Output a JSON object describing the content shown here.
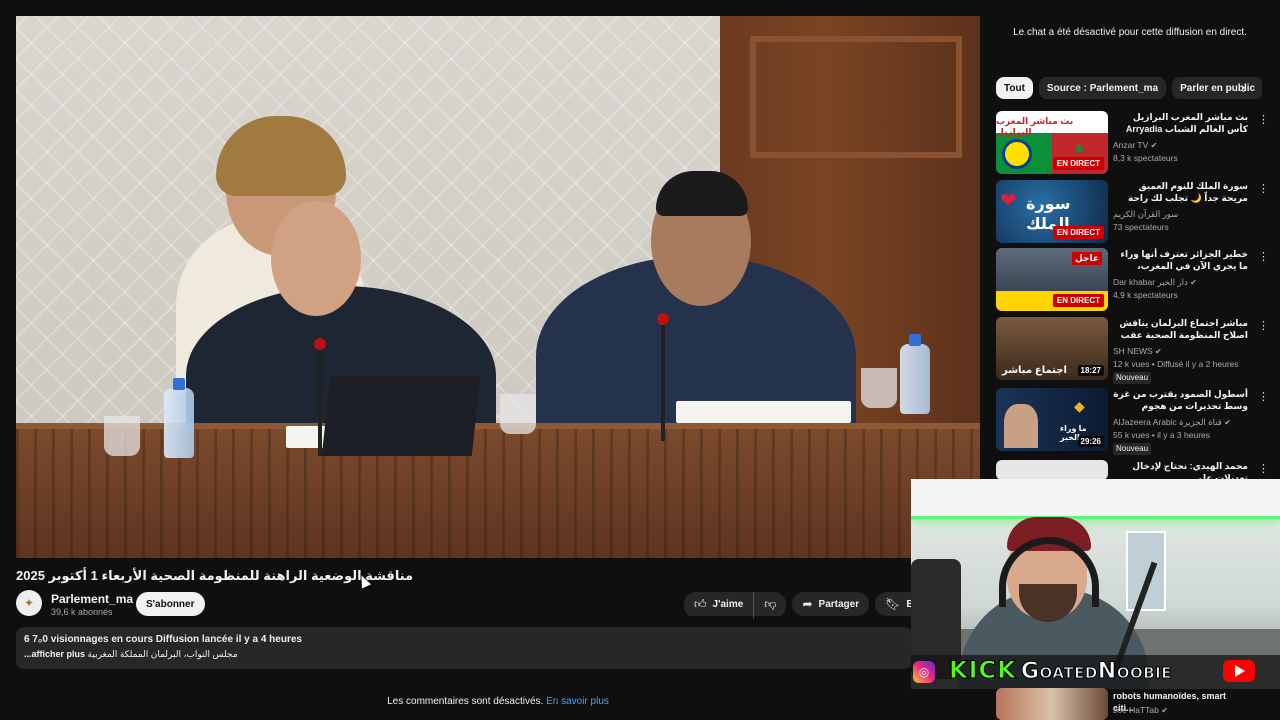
{
  "video": {
    "title": "مناقشة الوضعية الراهنة للمنظومة الصحية الأربعاء 1 أكتوبر 2025",
    "channel_name": "Parlement_ma",
    "channel_subs": "39,6 k abonnés",
    "subscribe_label": "S'abonner",
    "like_label": "J'aime",
    "share_label": "Partager",
    "save_label": "Enre",
    "description": {
      "line1_count": "6 7₀0",
      "line1_text": " visionnages en cours  Diffusion lancée il y a 4 heures",
      "line2_tags": "مجلس النواب، البرلمان المملكة المغربية",
      "line2_more": "...afficher plus"
    },
    "comments_disabled": "Les commentaires sont désactivés.",
    "comments_learn_more": "En savoir plus"
  },
  "sidebar": {
    "chat_disabled": "Le chat a été désactivé pour cette diffusion en direct.",
    "chips": [
      "Tout",
      "Source : Parlement_ma",
      "Parler en public"
    ],
    "recommendations": [
      {
        "title": "بث مباشر المغرب البرازيل كأس العالم الشباب Arryadia live 2025",
        "channel": "Anzar TV",
        "meta": "8,3 k spectateurs",
        "badge": "EN DIRECT",
        "thumb_text": "بث مباشر المغرب البرازيل"
      },
      {
        "title": "سورة الملك للنوم العميق مريحة جداً 🌙 تجلب لك راحة وطمأنينة عجيبة للشيخ حسن",
        "channel": "سور القرآن الكريم",
        "meta": "73 spectateurs",
        "badge": "EN DIRECT",
        "thumb_text": "سورة الملك"
      },
      {
        "title": "خطير الجزائر تعترف أنها وراء ما يجري الآن في المغرب، الملك محمد السادس فاجأ ...",
        "channel": "Dar khabar دار الخبر",
        "meta": "4,9 k spectateurs",
        "badge": "EN DIRECT",
        "thumb_text": "عاجل"
      },
      {
        "title": "مباشر اجتماع البرلمان يناقش اصلاح المنظومة الصحية عقب الاحتجاجات جيل Z ...",
        "channel": "SH NEWS",
        "meta": "12 k vues • Diffusé il y a 2 heures",
        "badge": "18:27",
        "new_label": "Nouveau",
        "thumb_text": "اجتماع مباشر"
      },
      {
        "title": "أسطول الصمود يقترب من غزة وسط تحذيرات من هجوم إسرائيلي محتمل...",
        "channel": "AlJazeera Arabic قناة الجزيرة",
        "meta": "55 k vues • il y a 3 heures",
        "badge": "29:26",
        "new_label": "Nouveau",
        "thumb_text": "ما وراء الخبر"
      },
      {
        "title": "محمد الهيدي: نحتاج لإدخال تعديلات على",
        "channel": "",
        "meta": "",
        "badge": "",
        "thumb_text": ""
      }
    ],
    "last_rec": {
      "title": "robots humanoïdes, smart citi...",
      "channel": "Joe HaTTab"
    }
  },
  "webcam": {
    "kick_label": "KICK",
    "handle": "GoatedNoobie"
  },
  "colors": {
    "background": "#0f0f0f",
    "surface": "#272727",
    "live_red": "#cc0000",
    "kick_green": "#53fc18",
    "link_blue": "#3ea6ff"
  }
}
